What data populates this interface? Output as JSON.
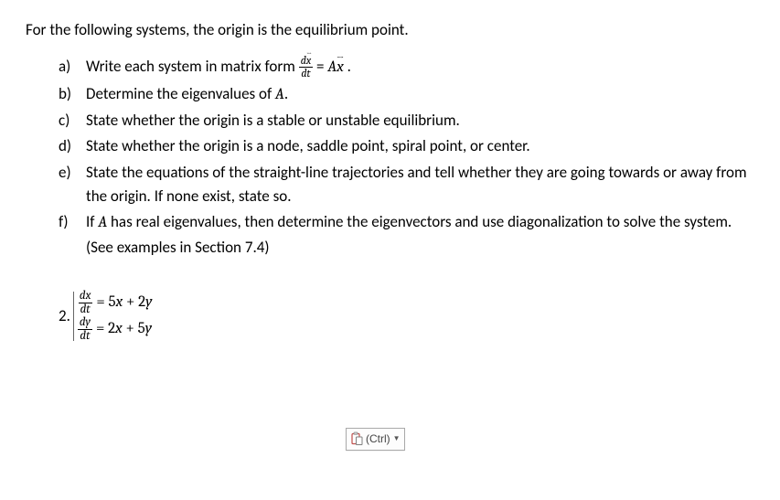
{
  "intro": "For the following systems, the origin is the equilibrium point.",
  "parts": {
    "a": {
      "label": "a)",
      "pre": "Write each system in matrix form ",
      "post": " ."
    },
    "b": {
      "label": "b)",
      "text": "Determine the eigenvalues of A."
    },
    "c": {
      "label": "c)",
      "text": "State whether the origin is a stable or unstable equilibrium."
    },
    "d": {
      "label": "d)",
      "text": "State whether the origin is a node, saddle point, spiral point, or center."
    },
    "e": {
      "label": "e)",
      "text": "State the equations of the straight-line trajectories and tell whether they are going towards or away from the origin.  If none exist, state so."
    },
    "f": {
      "label": "f)",
      "text": "If A has real eigenvalues, then determine the eigenvectors and use diagonalization to solve the system.  (See examples in Section 7.4)"
    }
  },
  "matrix_form": {
    "frac_num": "d x⃗",
    "frac_den": "dt",
    "eq": " = ",
    "A": "A",
    "xvec": "x⃗"
  },
  "problem": {
    "number": "2.",
    "eq1": {
      "num": "dx",
      "den": "dt",
      "rhs": " = 5x + 2y"
    },
    "eq2": {
      "num": "dy",
      "den": "dt",
      "rhs": " = 2x + 5y"
    }
  },
  "paste_tag": {
    "label": "(Ctrl) "
  }
}
